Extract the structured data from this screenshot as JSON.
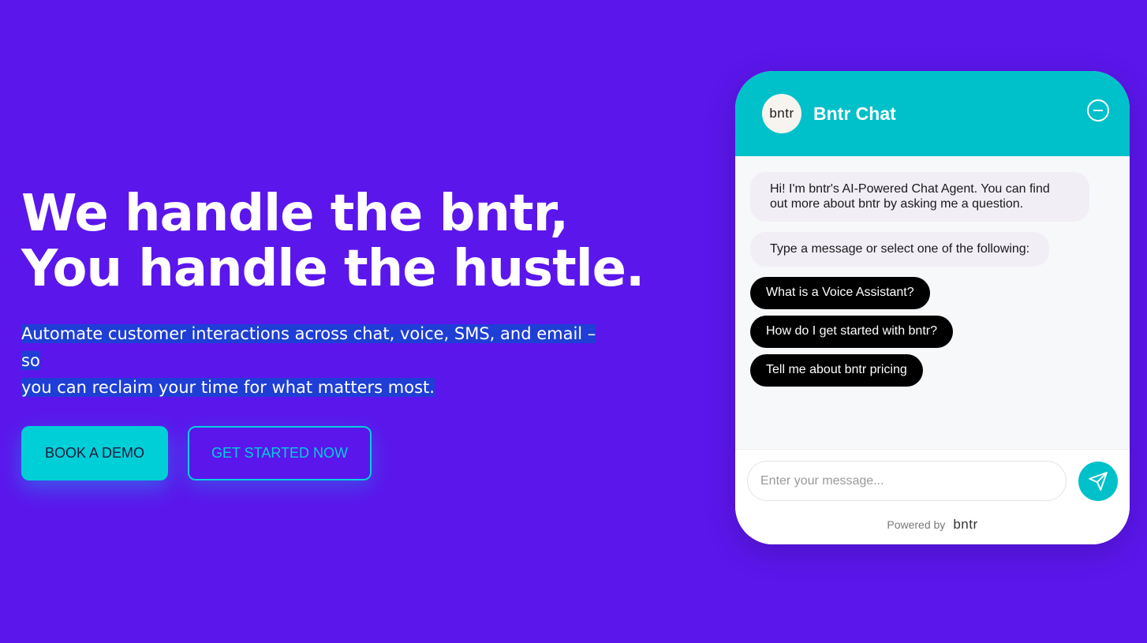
{
  "hero": {
    "headline_line1": "We handle the bntr,",
    "headline_line2": "You handle the hustle.",
    "subtext_line1": "Automate customer interactions across chat, voice, SMS, and email – so",
    "subtext_line2": "you can reclaim your time for what matters most.",
    "demo_button": "BOOK A DEMO",
    "start_button": "GET STARTED NOW"
  },
  "chat": {
    "logo_text": "bntr",
    "title": "Bntr Chat",
    "messages": [
      "Hi! I'm bntr's AI-Powered Chat Agent. You can find out more about bntr by asking me a question.",
      "Type a message or select one of the following:"
    ],
    "quick_replies": [
      "What is a Voice Assistant?",
      "How do I get started with bntr?",
      "Tell me about bntr pricing"
    ],
    "input_placeholder": "Enter your message...",
    "powered_label": "Powered by",
    "powered_logo": "bntr"
  },
  "colors": {
    "background": "#5b16ec",
    "accent": "#00c0c9",
    "highlight": "#1f3ed6"
  },
  "icons": [
    "minimize-icon",
    "send-icon"
  ]
}
